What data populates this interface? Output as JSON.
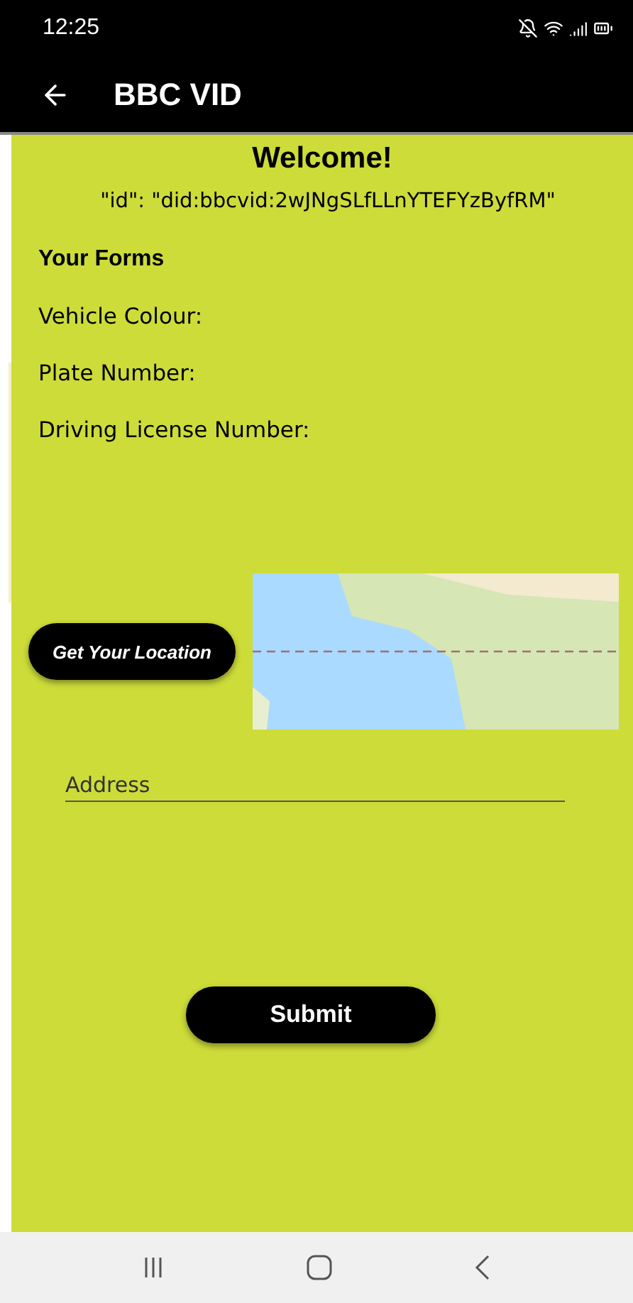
{
  "status_bar": {
    "time": "12:25"
  },
  "app_bar": {
    "title": "BBC VID"
  },
  "welcome": {
    "heading": "Welcome!",
    "id_line": "\"id\": \"did:bbcvid:2wJNgSLfLLnYTEFYzByfRM\""
  },
  "forms": {
    "heading": "Your Forms",
    "fields": [
      {
        "label": "Vehicle Colour:"
      },
      {
        "label": "Plate Number:"
      },
      {
        "label": "Driving License Number:"
      }
    ]
  },
  "location": {
    "button": "Get Your Location"
  },
  "address": {
    "placeholder": "Address"
  },
  "submit": {
    "label": "Submit"
  }
}
